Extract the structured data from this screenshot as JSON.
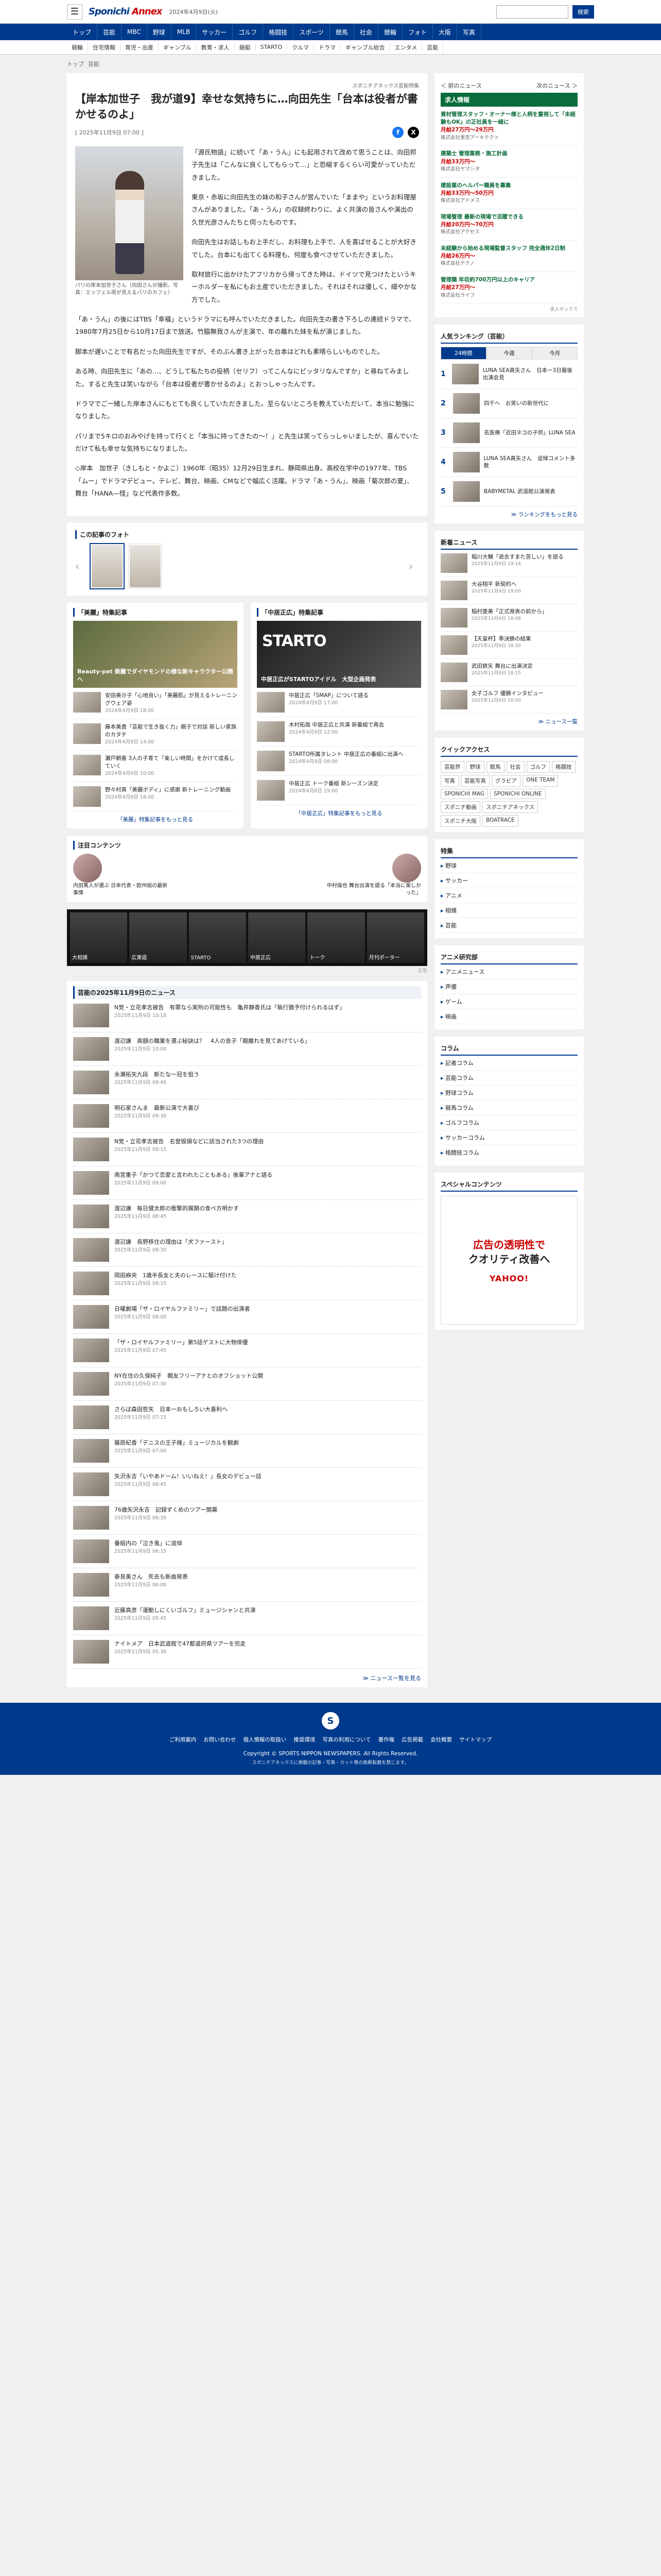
{
  "header": {
    "logo_a": "Sponichi",
    "logo_b": "Annex",
    "date": "2024年4月9日(火)",
    "search_placeholder": "",
    "search_button": "検索"
  },
  "nav1": [
    "トップ",
    "芸能",
    "MBC",
    "野球",
    "MLB",
    "サッカー",
    "ゴルフ",
    "格闘技",
    "スポーツ",
    "競馬",
    "社会",
    "競輪",
    "フォト",
    "大阪",
    "写真"
  ],
  "nav2": [
    "競輪",
    "住宅情報",
    "育児・出産",
    "ギャンブル",
    "教育・求人",
    "競艇",
    "STARTO",
    "クルマ",
    "ドラマ",
    "ギャンブル総合",
    "エンタメ",
    "芸能"
  ],
  "breadcrumb": [
    "トップ",
    "芸能"
  ],
  "article": {
    "category": "スポニチアネックス芸能特集",
    "title": "【岸本加世子　我が道9】幸せな気持ちに…向田先生「台本は役者が書かせるのよ」",
    "datetime": "[ 2025年11月9日 07:00 ]",
    "caption": "パリの岸本加世子さん（向田さんが撮影。写真：エッフェル塔が見えるパリのカフェ）",
    "paragraphs": [
      "「源氏物語」に続いて「あ・うん」にも起用されて改めて思うことは、向田邦子先生は「こんなに良くしてもらって…」と恐縮するくらい可愛がっていただきました。",
      "東京・赤坂に向田先生の妹の和子さんが営んでいた「ままや」というお料理屋さんがありました。「あ・うん」の収録終わりに、よく共演の皆さんや演出の久世光彦さんたちと伺ったものです。",
      "向田先生はお話しもお上手だし、お料理も上手で、人を喜ばせることが大好きでした。台本にも出てくる料理も、何度も食べさせていただきました。",
      "取材旅行に出かけたアフリカから帰ってきた時は、ドイツで見つけたというキーホルダーを私にもお土産でいただきました。それはそれは優しく、細やかな方でした。",
      "「あ・うん」の後にはTBS「幸福」というドラマにも呼んでいただきました。向田先生の書き下ろしの連続ドラマで、1980年7月25日から10月17日まで放送。竹脇無我さんが主演で、年の離れた妹を私が演じました。",
      "脚本が遅いことで有名だった向田先生ですが、そのぶん書き上がった台本はどれも素晴らしいものでした。",
      "ある時、向田先生に「あの…、どうして私たちの役柄（セリフ）ってこんなにピッタリなんですか」と尋ねてみました。すると先生は笑いながら「台本は役者が書かせるのよ」とおっしゃったんです。",
      "ドラマでご一緒した岸本さんにもとても良くしていただきました。至らないところを教えていただいて、本当に勉強になりました。",
      "パリまで5キロのおみやげを持って行くと「本当に持ってきたの〜！」と先生は笑ってらっしゃいましたが、喜んでいただけて私も幸せな気持ちになりました。",
      "◇岸本　加世子（きしもと・かよこ）1960年（昭35）12月29日生まれ、静岡県出身。高校在学中の1977年、TBS「ムー」でドラマデビュー。テレビ、舞台、映画、CMなどで幅広く活躍。ドラマ「あ・うん」、映画「菊次郎の夏」、舞台「HANA―怪」など代表作多数。"
    ],
    "share_fb": "f",
    "share_x": "X"
  },
  "photos": {
    "heading": "この記事のフォト",
    "prev": "‹",
    "next": "›"
  },
  "features": [
    {
      "heading": "「美麗」特集記事",
      "hero_title": "Beauty-pet 美麗でダイヤモンドの様な新キャラクター公開へ",
      "items": [
        {
          "t": "安田美沙子「心地良い」「美麗肌」が見えるトレーニングウェア姿",
          "d": "2024年4月9日 18:00"
        },
        {
          "t": "藤本美貴「芸能で生き抜く力」親子で対談 新しい家族のカタチ",
          "d": "2024年4月9日 14:00"
        },
        {
          "t": "瀬戸朝香 3人の子育て「楽しい時間」をかけて成長していく",
          "d": "2024年4月9日 10:00"
        },
        {
          "t": "野々村真「美麗ボディ」に感謝 新トレーニング動画",
          "d": "2024年4月8日 18:00"
        }
      ],
      "more": "「美麗」特集記事をもっと見る"
    },
    {
      "heading": "「中居正広」特集記事",
      "hero_big": "STARTO",
      "hero_title": "中居正広がSTARTOアイドル　大型企画発表",
      "items": [
        {
          "t": "中居正広「SMAP」について語る",
          "d": "2024年4月9日 17:00"
        },
        {
          "t": "木村拓哉 中居正広と共演 新番組で再会",
          "d": "2024年4月9日 12:00"
        },
        {
          "t": "STARTO所属タレント 中居正広の番組に出演へ",
          "d": "2024年4月9日 08:00"
        },
        {
          "t": "中居正広 トーク番組 新シーズン決定",
          "d": "2024年4月8日 19:00"
        }
      ],
      "more": "「中居正広」特集記事をもっと見る"
    }
  ],
  "notice": {
    "heading": "注目コンテンツ",
    "left": "内田篤人が選ぶ 日本代表・欧州組の最新事情",
    "right": "中村倫也 舞台出演を語る「本当に楽しかった」"
  },
  "ad_banner": [
    "大相撲",
    "広東語",
    "STARTO",
    "中居正広",
    "トーク",
    "月刊ポーター"
  ],
  "ad_label": "広告",
  "today": {
    "heading": "芸能の2025年11月9日のニュース",
    "items": [
      {
        "t": "N党・立花孝志被告　有罪なら実刑の可能性も　亀井静香氏は「執行猶予付けられるはず」",
        "d": "2025年11月9日 10:18"
      },
      {
        "t": "渡辺謙　高額の職業を選ぶ秘訣は？　4人の息子「親離れを見てあげている」",
        "d": "2025年11月9日 10:00"
      },
      {
        "t": "永瀬拓矢九段　新たな一冠を狙う",
        "d": "2025年11月9日 09:45"
      },
      {
        "t": "明石家さんま　最新公演で大喜び",
        "d": "2025年11月9日 09:30"
      },
      {
        "t": "N党・立花孝志被告　名誉毀損などに該当された3つの理由",
        "d": "2025年11月9日 09:15"
      },
      {
        "t": "南宮重子「かつて恋愛と言われたこともある」後輩アナと語る",
        "d": "2025年11月9日 09:00"
      },
      {
        "t": "渡辺謙　毎日健太郎の衝撃的展開の食べ方明かす",
        "d": "2025年11月9日 08:45"
      },
      {
        "t": "渡辺謙　長野移住の理由は「犬ファースト」",
        "d": "2025年11月9日 08:30"
      },
      {
        "t": "岡田麻央　1歳半長女と夫のレースに駆け付けた",
        "d": "2025年11月9日 08:15"
      },
      {
        "t": "日曜劇場「ザ・ロイヤルファミリー」で話題の出演者",
        "d": "2025年11月9日 08:00"
      },
      {
        "t": "「ザ・ロイヤルファミリー」第5話ゲストに大物俳優",
        "d": "2025年11月9日 07:45"
      },
      {
        "t": "NY在住の久保純子　親友フリーアナとのオフショット公開",
        "d": "2025年11月9日 07:30"
      },
      {
        "t": "さらば森田哲矢　日本一おもしろい大喜利へ",
        "d": "2025年11月9日 07:15"
      },
      {
        "t": "藤原紀香「デニスの王子様」ミュージカルを観劇",
        "d": "2025年11月9日 07:00"
      },
      {
        "t": "矢沢永吉「いやあドーム！いいねえ！」長女のデビュー話",
        "d": "2025年11月9日 06:45"
      },
      {
        "t": "76歳矢沢永吉　記録ずくめのツアー開幕",
        "d": "2025年11月9日 06:30"
      },
      {
        "t": "番組内の「泣き鬼」に追悼",
        "d": "2025年11月9日 06:15"
      },
      {
        "t": "泰良美さん　死去も新曲発表",
        "d": "2025年11月9日 06:00"
      },
      {
        "t": "近藤真彦「運動しにくいゴルフ」ミュージシャンと共演",
        "d": "2025年11月9日 05:45"
      },
      {
        "t": "ナイトメア　日本武道館で47都道府県ツアーを完走",
        "d": "2025年11月9日 05:30"
      }
    ],
    "more": "≫ ニュース一覧を見る"
  },
  "side": {
    "topbar_left": "＜ 前のニュース",
    "topbar_right": "次のニュース ＞",
    "jobs_heading": "求人情報",
    "jobs": [
      {
        "t": "資材管理スタッフ・オーナー様と人柄を重視して「未経験もOK」の正社員を一緒に",
        "p": "月給27万円〜29万円",
        "c": "株式会社東京アーキテクト"
      },
      {
        "t": "建築士 管理業務・施工計画",
        "p": "月給33万円〜",
        "c": "株式会社ヤマシタ"
      },
      {
        "t": "建設業のヘルパー職員を募集",
        "p": "月給33万円〜50万円",
        "c": "株式会社アドメス"
      },
      {
        "t": "現場管理 最新の現場で活躍できる",
        "p": "月給20万円〜70万円",
        "c": "株式会社アクセス"
      },
      {
        "t": "未経験から始める現場監督スタッフ 完全週休2日制",
        "p": "月給26万円〜",
        "c": "株式会社テクノ"
      },
      {
        "t": "管理職 年収約700万円以上のキャリア",
        "p": "月給27万円〜",
        "c": "株式会社ライフ"
      }
    ],
    "jobs_foot": "求人ボックス",
    "ranking_heading": "人気ランキング（芸能）",
    "ranking_tabs": [
      "24時間",
      "今週",
      "今月"
    ],
    "ranking": [
      "LUNA SEA真矢さん　日本ー3日最後出演会見",
      "四千ヘ　お笑いの新世代に",
      "名医療「近田ネコの子供」LUNA SEA",
      "LUNA SEA真矢さん　追悼コメント多数",
      "BABYMETAL 武道館公演発表"
    ],
    "ranking_more": "≫ ランキングをもっと見る",
    "news_heading": "新着ニュース",
    "news": [
      {
        "t": "稲川大輔「逝去すまた苦しい」を語る",
        "d": "2025年11月9日 19:14"
      },
      {
        "t": "大谷翔平 新契約へ",
        "d": "2025年11月9日 19:00"
      },
      {
        "t": "稲村亜美「正式発表の前から」",
        "d": "2025年11月9日 18:48"
      },
      {
        "t": "【天皇杯】準決勝の結果",
        "d": "2025年11月9日 18:30"
      },
      {
        "t": "武田鉄矢 舞台に出演決定",
        "d": "2025年11月9日 18:15"
      },
      {
        "t": "女子ゴルフ 優勝インタビュー",
        "d": "2025年11月9日 18:00"
      }
    ],
    "news_more": "≫ ニュース一覧",
    "qa_heading": "クイックアクセス",
    "qa": [
      "芸能界",
      "野球",
      "競馬",
      "社会",
      "ゴルフ",
      "格闘技",
      "写真",
      "芸能写真",
      "グラビア",
      "ONE TEAM",
      "SPONICHI MAG",
      "SPONICHI ONLINE",
      "スポニチ動画",
      "スポニチアネックス",
      "スポニチ大阪",
      "BOATRACE"
    ],
    "special_heading": "特集",
    "special": [
      "野球",
      "サッカー",
      "アニメ",
      "相撲",
      "芸能"
    ],
    "anime_heading": "アニメ研究部",
    "anime": [
      "アニメニュース",
      "声優",
      "ゲーム",
      "映画"
    ],
    "column_heading": "コラム",
    "column": [
      "記者コラム",
      "芸能コラム",
      "野球コラム",
      "競馬コラム",
      "ゴルフコラム",
      "サッカーコラム",
      "格闘技コラム"
    ],
    "spad_heading": "スペシャルコンテンツ",
    "spad_l1": "広告の透明性で",
    "spad_l2": "クオリティ改善へ",
    "spad_brand": "YAHOO!"
  },
  "footer": {
    "logo": "S",
    "links": [
      "ご利用案内",
      "お問い合わせ",
      "個人情報の取扱い",
      "推奨環境",
      "写真の利用について",
      "著作権",
      "広告掲載",
      "会社概要",
      "サイトマップ"
    ],
    "copy": "Copyright © SPORTS NIPPON NEWSPAPERS. All Rights Reserved.",
    "note": "スポニチアネックスに掲載の記事・写真・カット等の無断転載を禁じます。"
  },
  "colors": {
    "brand": "#003a8c",
    "accent": "#c00000",
    "job": "#0a6c3a"
  }
}
